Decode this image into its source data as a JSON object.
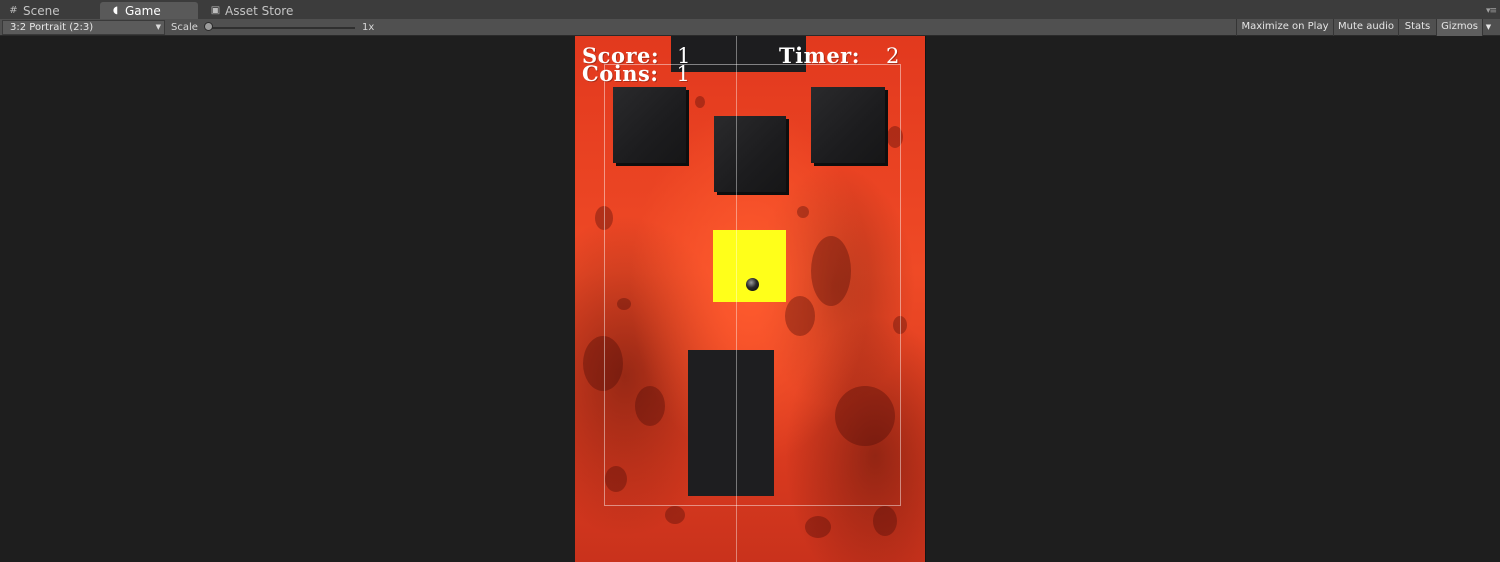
{
  "tabs": [
    {
      "label": "Scene",
      "icon": "grid-icon"
    },
    {
      "label": "Game",
      "icon": "pacman-icon"
    },
    {
      "label": "Asset Store",
      "icon": "store-bag-icon"
    }
  ],
  "toolbar": {
    "aspect": "3:2 Portrait (2:3)",
    "scale_label": "Scale",
    "scale_value": "1x",
    "maximize_on_play": "Maximize on Play",
    "mute_audio": "Mute audio",
    "stats": "Stats",
    "gizmos": "Gizmos"
  },
  "hud": {
    "score_label": "Score:",
    "score_value": "1",
    "coins_label": "Coins:",
    "coins_value": "1",
    "timer_label": "Timer:",
    "timer_value": "2"
  },
  "colors": {
    "background": "#e2391e",
    "tile": "#ffff1a",
    "block": "#1e1e20"
  }
}
